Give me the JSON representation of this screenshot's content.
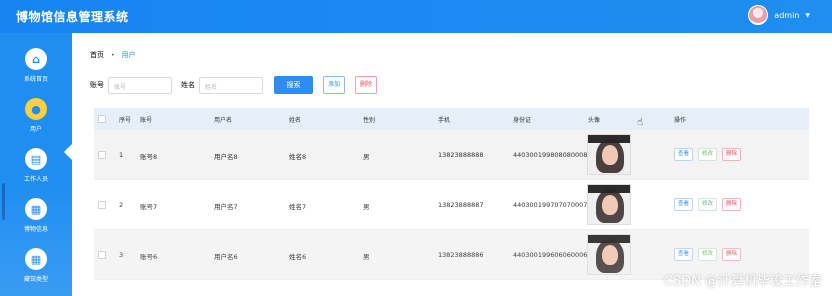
{
  "app": {
    "title": "博物馆信息管理系统",
    "user": "admin",
    "watermark": "CSDN @计算机毕设工作室"
  },
  "sidebar": {
    "items": [
      {
        "label": "系统首页",
        "icon": "home-icon"
      },
      {
        "label": "用户",
        "icon": "user-icon"
      },
      {
        "label": "工作人员",
        "icon": "wallet-icon"
      },
      {
        "label": "博物信息",
        "icon": "grid-icon"
      },
      {
        "label": "藏馆类型",
        "icon": "grid-icon"
      }
    ]
  },
  "breadcrumb": {
    "home": "首页",
    "current": "用户"
  },
  "search": {
    "account_label": "账号",
    "account_placeholder": "账号",
    "name_label": "姓名",
    "name_placeholder": "姓名",
    "search_label": "搜索",
    "add_label": "添加",
    "delete_label": "删除"
  },
  "table": {
    "columns": [
      "序号",
      "账号",
      "用户名",
      "姓名",
      "性别",
      "手机",
      "身份证",
      "头像",
      "操作"
    ],
    "rows": [
      {
        "no": "1",
        "account": "账号8",
        "username": "用户名8",
        "name": "姓名8",
        "gender": "男",
        "phone": "13823888888",
        "idcard": "440300199808080008"
      },
      {
        "no": "2",
        "account": "账号7",
        "username": "用户名7",
        "name": "姓名7",
        "gender": "男",
        "phone": "13823888887",
        "idcard": "440300199707070007"
      },
      {
        "no": "3",
        "account": "账号6",
        "username": "用户名6",
        "name": "姓名6",
        "gender": "男",
        "phone": "13823888886",
        "idcard": "440300199606060006"
      }
    ],
    "actions": {
      "view": "查看",
      "edit": "修改",
      "delete": "删除"
    }
  }
}
